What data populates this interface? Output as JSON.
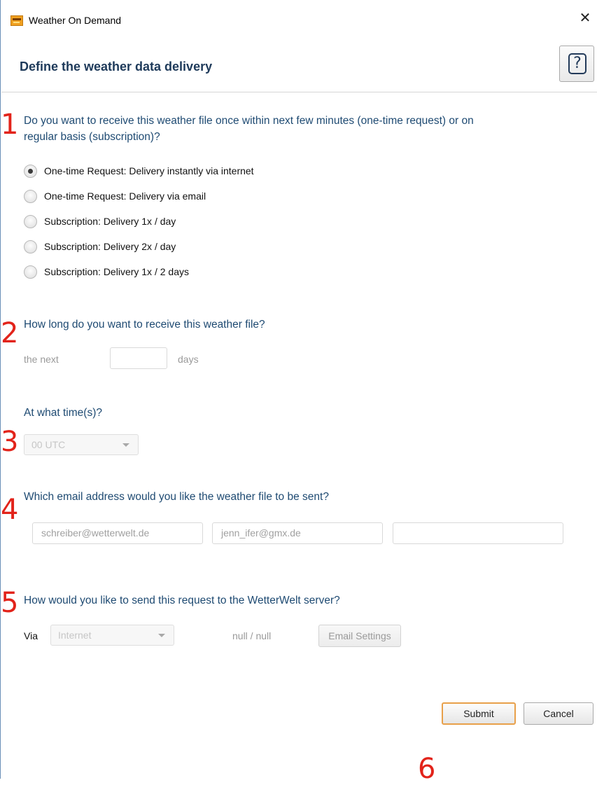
{
  "window": {
    "title": "Weather On Demand",
    "close_glyph": "✕",
    "app_icon": "app-logo-icon"
  },
  "header": {
    "title": "Define the weather data delivery",
    "help_glyph": "?"
  },
  "steps": [
    "1",
    "2",
    "3",
    "4",
    "5",
    "6"
  ],
  "section1": {
    "question_line1": "Do you want to receive this weather file once within next few minutes (one-time request) or on",
    "question_line2": "regular basis (subscription)?",
    "options": [
      {
        "label": "One-time Request: Delivery instantly via internet",
        "checked": true
      },
      {
        "label": "One-time Request: Delivery via email",
        "checked": false
      },
      {
        "label": "Subscription: Delivery 1x / day",
        "checked": false
      },
      {
        "label": "Subscription: Delivery 2x / day",
        "checked": false
      },
      {
        "label": "Subscription: Delivery 1x / 2 days",
        "checked": false
      }
    ]
  },
  "section2": {
    "question": "How long do you want to receive this weather file?",
    "prefix": "the next",
    "days_value": "",
    "suffix": "days"
  },
  "section3": {
    "question": "At what time(s)?",
    "time_selected": "00 UTC"
  },
  "section4": {
    "question": "Which email address would you like the weather file to be sent?",
    "emails": [
      "schreiber@wetterwelt.de",
      "jenn_ifer@gmx.de",
      ""
    ]
  },
  "section5": {
    "question": "How would you like to send this request to the WetterWelt server?",
    "via_label": "Via",
    "via_selected": "Internet",
    "status_text": "null / null",
    "email_settings_label": "Email Settings"
  },
  "footer": {
    "submit_label": "Submit",
    "cancel_label": "Cancel"
  },
  "colors": {
    "accent_step": "#e2231a",
    "question_text": "#1e4a72",
    "header_title": "#1e3a5a",
    "submit_border": "#e8a04a"
  }
}
